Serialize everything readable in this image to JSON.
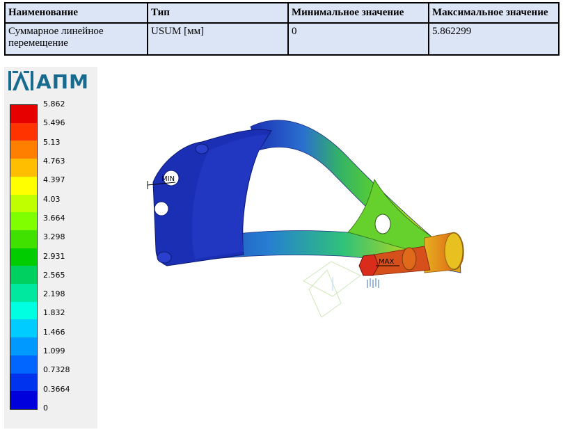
{
  "results_table": {
    "headers": [
      "Наименование",
      "Тип",
      "Минимальное значение",
      "Максимальное значение"
    ],
    "row": {
      "name": "Суммарное линейное перемещение",
      "type": "USUM [мм]",
      "min": "0",
      "max": "5.862299"
    }
  },
  "logo": {
    "text": "АПМ"
  },
  "legend": {
    "values": [
      "5.862",
      "5.496",
      "5.13",
      "4.763",
      "4.397",
      "4.03",
      "3.664",
      "3.298",
      "2.931",
      "2.565",
      "2.198",
      "1.832",
      "1.466",
      "1.099",
      "0.7328",
      "0.3664",
      "0"
    ],
    "colors": [
      "#e60000",
      "#ff3300",
      "#ff8000",
      "#ffbf00",
      "#ffff00",
      "#bfff00",
      "#80ff00",
      "#40e000",
      "#00cc00",
      "#00d060",
      "#00e8a0",
      "#00ffe0",
      "#00ccff",
      "#0099ff",
      "#0066ff",
      "#0033ee",
      "#0000dd"
    ]
  },
  "viewport": {
    "min_marker": "MIN",
    "max_marker": "MAX",
    "colors": {
      "model_dark": "#1b2fb4",
      "model_light": "#2f45d8",
      "hot": "#d92c1a"
    }
  }
}
